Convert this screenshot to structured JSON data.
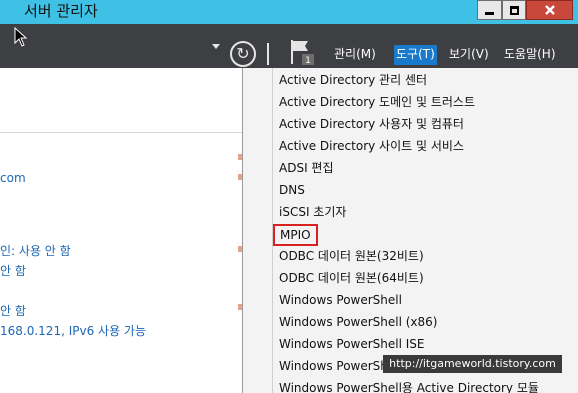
{
  "window": {
    "title": "서버 관리자"
  },
  "toolbar": {
    "menus": [
      "관리(M)",
      "도구(T)",
      "보기(V)",
      "도움말(H)"
    ],
    "notification_count": "1",
    "refresh_glyph": "↻"
  },
  "left_pane": {
    "lines": [
      "com",
      "인: 사용 안 함",
      "안 함",
      "안 함",
      "168.0.121, IPv6 사용 가능"
    ]
  },
  "tools_menu": {
    "items": [
      "Active Directory 관리 센터",
      "Active Directory 도메인 및 트러스트",
      "Active Directory 사용자 및 컴퓨터",
      "Active Directory 사이트 및 서비스",
      "ADSI 편집",
      "DNS",
      "iSCSI 초기자",
      "MPIO",
      "ODBC 데이터 원본(32비트)",
      "ODBC 데이터 원본(64비트)",
      "Windows PowerShell",
      "Windows PowerShell (x86)",
      "Windows PowerShell ISE",
      "Windows PowerShell ISE (x86)",
      "Windows PowerShell용 Active Directory 모듈"
    ],
    "highlighted_item": "MPIO"
  },
  "watermark": "http://itgameworld.tistory.com",
  "colors": {
    "titlebar": "#3fc1e6",
    "toolbar": "#3e3f42",
    "menu_active": "#1979ca",
    "link_text": "#1c67b4",
    "highlight_border": "#d82222"
  }
}
